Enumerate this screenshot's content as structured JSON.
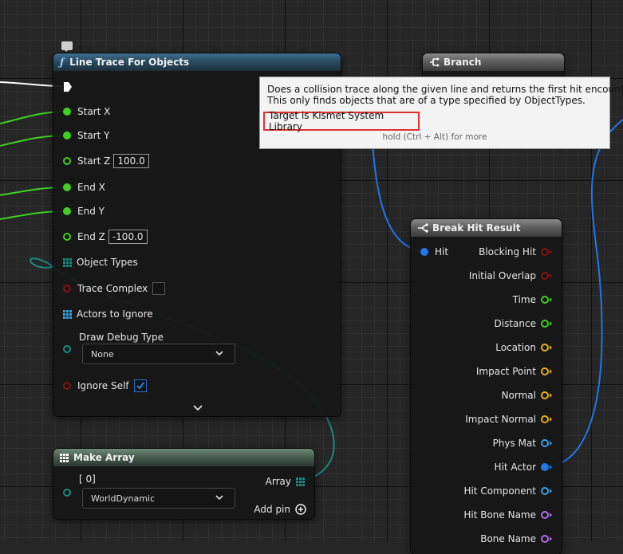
{
  "line_trace": {
    "title": "Line Trace For Objects",
    "function_glyph": "ƒ",
    "pins": {
      "start_x": "Start X",
      "start_y": "Start Y",
      "start_z": "Start Z",
      "start_z_value": "100.0",
      "end_x": "End X",
      "end_y": "End Y",
      "end_z": "End Z",
      "end_z_value": "-100.0",
      "object_types": "Object Types",
      "trace_complex": "Trace Complex",
      "actors_to_ignore": "Actors to Ignore",
      "draw_debug_type": "Draw Debug Type",
      "draw_debug_value": "None",
      "ignore_self": "Ignore Self"
    },
    "trace_complex_checked": false,
    "ignore_self_checked": true
  },
  "branch": {
    "title": "Branch"
  },
  "tooltip": {
    "line1": "Does a collision trace along the given line and returns the first hit encountered.",
    "line2": "This only finds objects that are of a type specified by ObjectTypes.",
    "target": "Target is Kismet System Library",
    "hint": "hold (Ctrl + Alt) for more"
  },
  "break_hit": {
    "title": "Break Hit Result",
    "input": "Hit",
    "outputs": [
      {
        "label": "Blocking Hit",
        "color": "#8a1010"
      },
      {
        "label": "Initial Overlap",
        "color": "#8a1010"
      },
      {
        "label": "Time",
        "color": "#40d020"
      },
      {
        "label": "Distance",
        "color": "#40d020"
      },
      {
        "label": "Location",
        "color": "#e0b020"
      },
      {
        "label": "Impact Point",
        "color": "#e0b020"
      },
      {
        "label": "Normal",
        "color": "#e0b020"
      },
      {
        "label": "Impact Normal",
        "color": "#e0b020"
      },
      {
        "label": "Phys Mat",
        "color": "#3aa0e0"
      },
      {
        "label": "Hit Actor",
        "color": "#1e78e8"
      },
      {
        "label": "Hit Component",
        "color": "#3aa0e0"
      },
      {
        "label": "Hit Bone Name",
        "color": "#b070e0"
      },
      {
        "label": "Bone Name",
        "color": "#b070e0"
      }
    ]
  },
  "make_array": {
    "title": "Make Array",
    "index_label": "[ 0]",
    "element_value": "WorldDynamic",
    "output": "Array",
    "add_pin": "Add pin"
  },
  "colors": {
    "exec_wire": "#ffffff",
    "float_wire": "#40d020",
    "object_wire": "#1e78e8",
    "array_wire": "#1a8a80",
    "highlight": "#e03030"
  }
}
